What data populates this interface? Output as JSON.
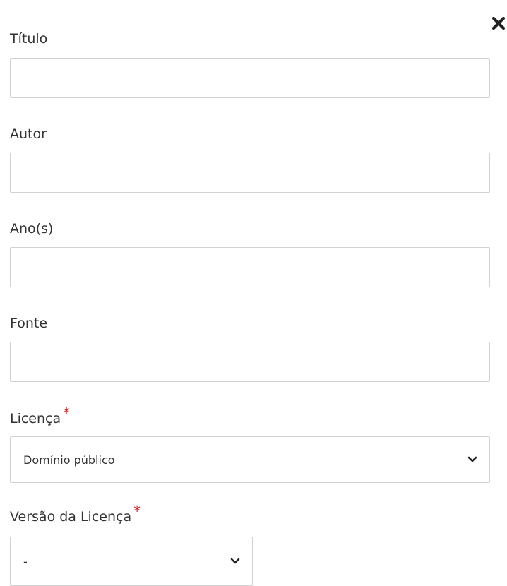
{
  "dialog": {
    "close_icon": "close-icon"
  },
  "fields": {
    "titulo": {
      "label": "Título",
      "value": "",
      "placeholder": ""
    },
    "autor": {
      "label": "Autor",
      "value": "",
      "placeholder": ""
    },
    "anos": {
      "label": "Ano(s)",
      "value": "",
      "placeholder": ""
    },
    "fonte": {
      "label": "Fonte",
      "value": "",
      "placeholder": ""
    },
    "licenca": {
      "label": "Licença",
      "required_mark": "*",
      "selected": "Domínio público",
      "icon": "chevron-down-icon"
    },
    "versao_licenca": {
      "label": "Versão da Licença",
      "required_mark": "*",
      "selected": "-",
      "icon": "chevron-down-icon"
    }
  },
  "colors": {
    "required": "#d21f1f",
    "border": "#d2d2d2",
    "text": "#333333"
  }
}
